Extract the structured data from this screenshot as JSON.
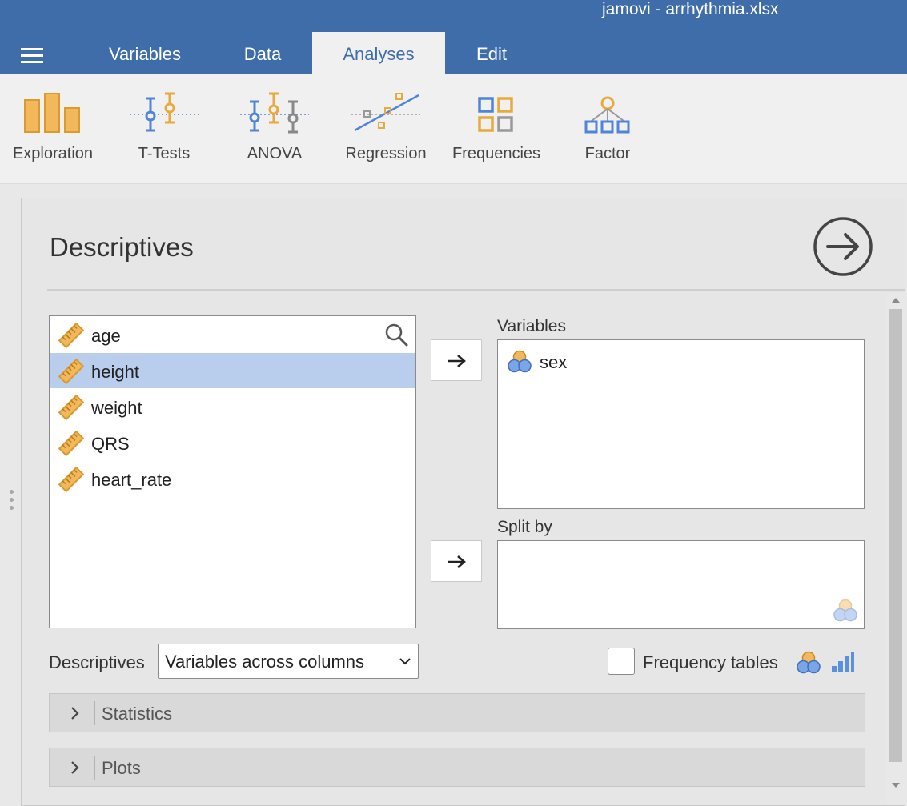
{
  "app": {
    "title": "jamovi - arrhythmia.xlsx"
  },
  "tabs": [
    {
      "label": "Variables"
    },
    {
      "label": "Data"
    },
    {
      "label": "Analyses",
      "active": true
    },
    {
      "label": "Edit"
    }
  ],
  "ribbon": [
    {
      "label": "Exploration",
      "icon": "exploration-icon"
    },
    {
      "label": "T-Tests",
      "icon": "t-tests-icon"
    },
    {
      "label": "ANOVA",
      "icon": "anova-icon"
    },
    {
      "label": "Regression",
      "icon": "regression-icon"
    },
    {
      "label": "Frequencies",
      "icon": "frequencies-icon"
    },
    {
      "label": "Factor",
      "icon": "factor-icon"
    }
  ],
  "analysis": {
    "title": "Descriptives",
    "source_variables": [
      {
        "name": "age",
        "type": "continuous"
      },
      {
        "name": "height",
        "type": "continuous",
        "selected": true
      },
      {
        "name": "weight",
        "type": "continuous"
      },
      {
        "name": "QRS",
        "type": "continuous"
      },
      {
        "name": "heart_rate",
        "type": "continuous"
      }
    ],
    "variables_label": "Variables",
    "variables": [
      {
        "name": "sex",
        "type": "nominal"
      }
    ],
    "split_by_label": "Split by",
    "split_by": [],
    "descriptives_label": "Descriptives",
    "descriptives_value": "Variables across columns",
    "frequency_tables_label": "Frequency tables",
    "frequency_tables_checked": false,
    "sections": [
      {
        "label": "Statistics"
      },
      {
        "label": "Plots"
      }
    ]
  },
  "colors": {
    "header_blue": "#3e6da9",
    "continuous_orange": "#e9a93b",
    "nominal_blue": "#4f84d6",
    "selection": "#b9cdec"
  }
}
